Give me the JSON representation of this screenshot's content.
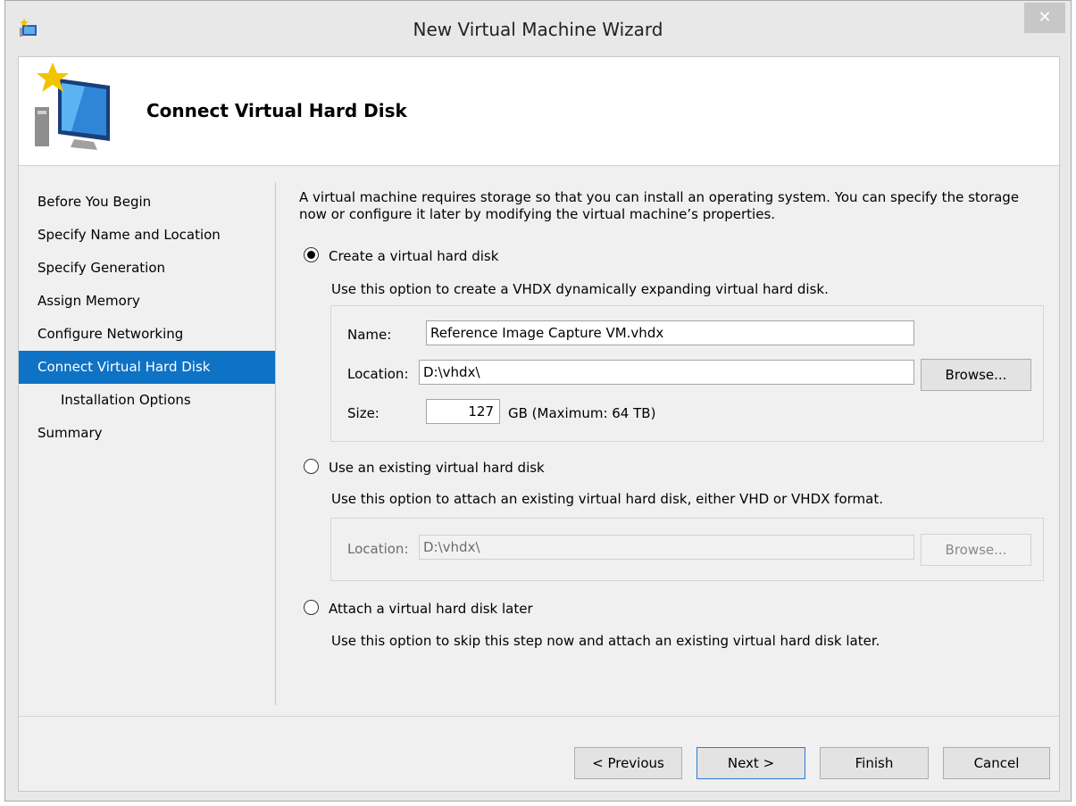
{
  "window": {
    "title": "New Virtual Machine Wizard",
    "close_glyph": "✕"
  },
  "header": {
    "title": "Connect Virtual Hard Disk",
    "icon": "new-vm-monitor-icon"
  },
  "nav": {
    "items": [
      {
        "label": "Before You Begin"
      },
      {
        "label": "Specify Name and Location"
      },
      {
        "label": "Specify Generation"
      },
      {
        "label": "Assign Memory"
      },
      {
        "label": "Configure Networking"
      },
      {
        "label": "Connect Virtual Hard Disk"
      },
      {
        "label": "Installation Options"
      },
      {
        "label": "Summary"
      }
    ],
    "active_index": 5
  },
  "main": {
    "description": "A virtual machine requires storage so that you can install an operating system. You can specify the storage now or configure it later by modifying the virtual machine’s properties.",
    "option_create": {
      "label": "Create a virtual hard disk",
      "selected": true,
      "description": "Use this option to create a VHDX dynamically expanding virtual hard disk.",
      "name_label": "Name:",
      "name_value": "Reference Image Capture VM.vhdx",
      "location_label": "Location:",
      "location_value": "D:\\vhdx\\",
      "browse_label": "Browse...",
      "size_label": "Size:",
      "size_value": "127",
      "size_unit": "GB (Maximum: 64 TB)"
    },
    "option_existing": {
      "label": "Use an existing virtual hard disk",
      "selected": false,
      "description": "Use this option to attach an existing virtual hard disk, either VHD or VHDX format.",
      "location_label": "Location:",
      "location_value": "D:\\vhdx\\",
      "browse_label": "Browse..."
    },
    "option_later": {
      "label": "Attach a virtual hard disk later",
      "selected": false,
      "description": "Use this option to skip this step now and attach an existing virtual hard disk later."
    }
  },
  "footer": {
    "previous": "< Previous",
    "next": "Next >",
    "finish": "Finish",
    "cancel": "Cancel"
  },
  "colors": {
    "accent": "#0e72c5",
    "window_bg": "#f0f0f0"
  }
}
